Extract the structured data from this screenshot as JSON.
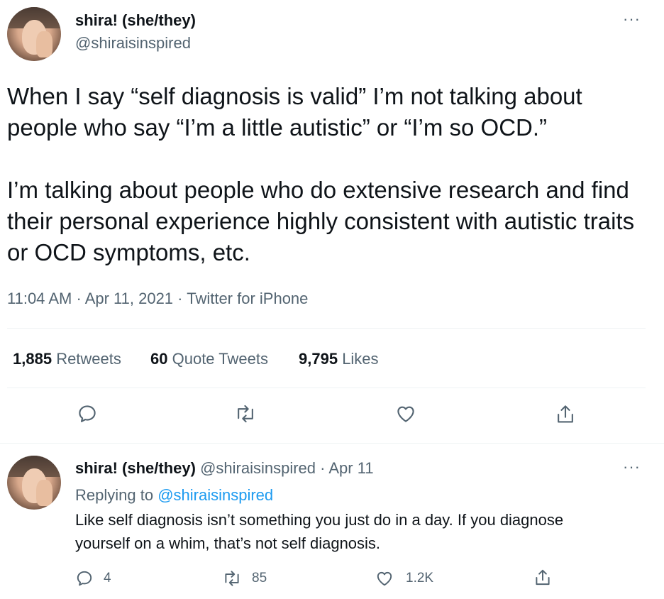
{
  "main_tweet": {
    "author_name": "shira! (she/they)",
    "handle": "@shiraisinspired",
    "more": "···",
    "text": "When I say “self diagnosis is valid” I’m not talking about people who say “I’m a little autistic” or “I’m so OCD.”\n\nI’m talking about people who do extensive research and find their personal experience highly consistent with autistic traits or OCD symptoms, etc.",
    "time": "11:04 AM",
    "date": "Apr 11, 2021",
    "source": "Twitter for iPhone",
    "sep": "·",
    "stats": {
      "retweets_count": "1,885",
      "retweets_label": "Retweets",
      "quotes_count": "60",
      "quotes_label": "Quote Tweets",
      "likes_count": "9,795",
      "likes_label": "Likes"
    }
  },
  "reply": {
    "author_name": "shira! (she/they)",
    "handle": "@shiraisinspired",
    "sep": "·",
    "date": "Apr 11",
    "more": "···",
    "replying_prefix": "Replying to",
    "replying_handle": "@shiraisinspired",
    "text": "Like self diagnosis isn’t something you just do in a day. If you diagnose yourself on a whim, that’s not self diagnosis.",
    "replies": "4",
    "retweets": "85",
    "likes": "1.2K"
  },
  "colors": {
    "text": "#0f1419",
    "secondary": "#536471",
    "link": "#1d9bf0",
    "divider": "#eff3f4"
  },
  "icons": [
    "reply-icon",
    "retweet-icon",
    "like-icon",
    "share-icon",
    "more-icon"
  ]
}
